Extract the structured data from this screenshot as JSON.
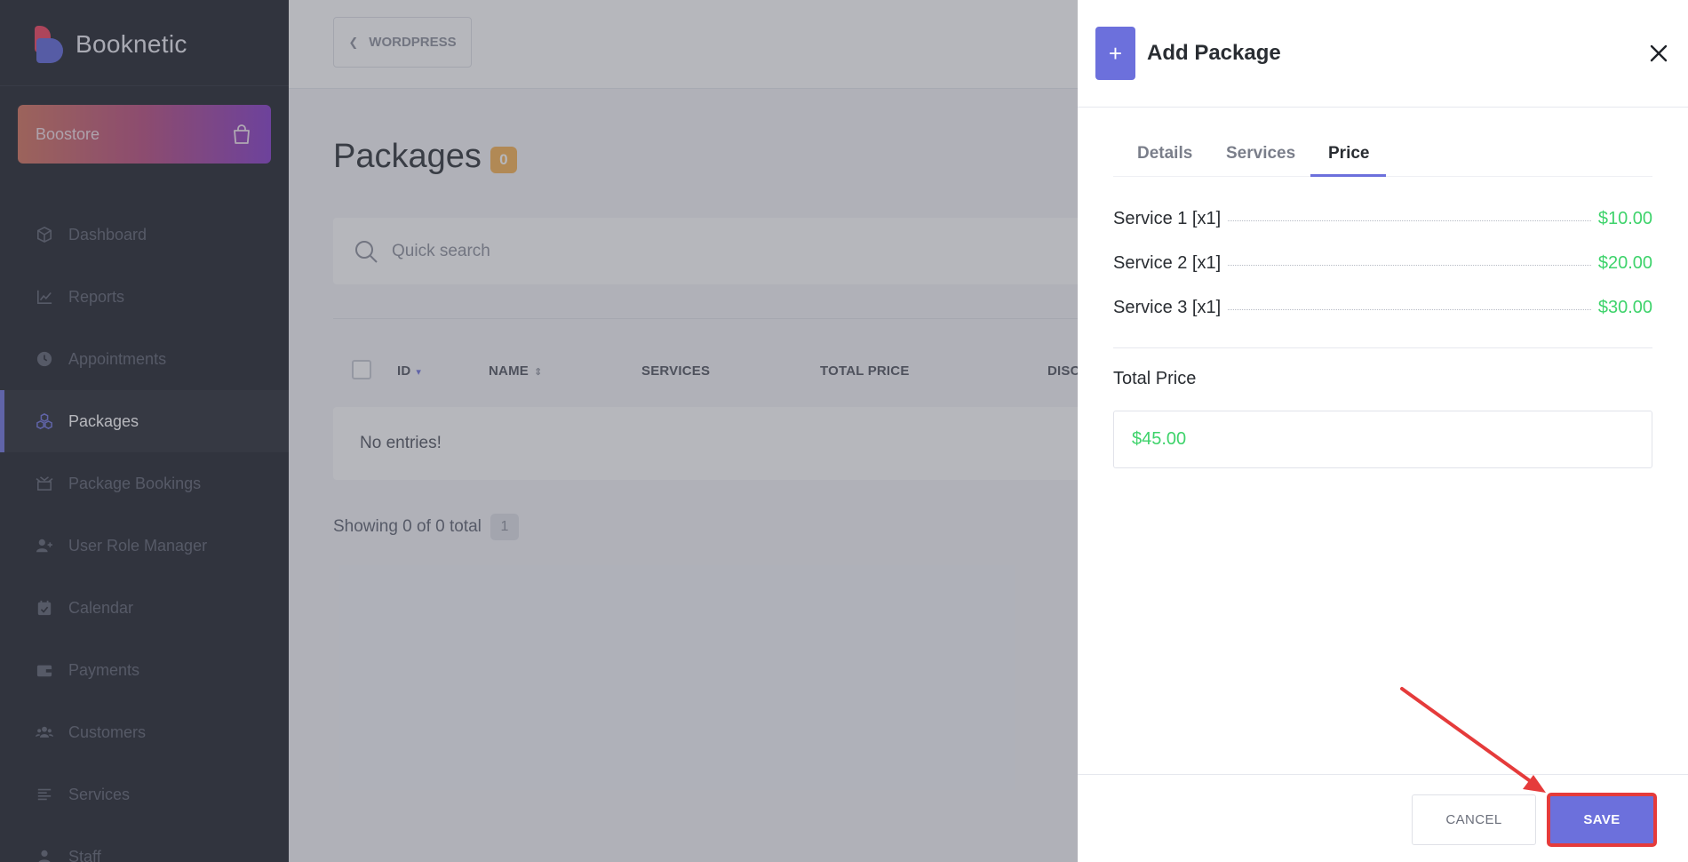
{
  "sidebar": {
    "brand": "Booknetic",
    "boostore_label": "Boostore",
    "items": [
      {
        "label": "Dashboard",
        "icon": "cube-icon",
        "active": false
      },
      {
        "label": "Reports",
        "icon": "chart-line-icon",
        "active": false
      },
      {
        "label": "Appointments",
        "icon": "clock-icon",
        "active": false
      },
      {
        "label": "Packages",
        "icon": "cubes-icon",
        "active": true
      },
      {
        "label": "Package Bookings",
        "icon": "box-open-icon",
        "active": false
      },
      {
        "label": "User Role Manager",
        "icon": "user-plus-icon",
        "active": false
      },
      {
        "label": "Calendar",
        "icon": "calendar-check-icon",
        "active": false
      },
      {
        "label": "Payments",
        "icon": "wallet-icon",
        "active": false
      },
      {
        "label": "Customers",
        "icon": "users-icon",
        "active": false
      },
      {
        "label": "Services",
        "icon": "list-icon",
        "active": false
      },
      {
        "label": "Staff",
        "icon": "user-icon",
        "active": false
      }
    ]
  },
  "main": {
    "back_label": "WORDPRESS",
    "page_title": "Packages",
    "count": "0",
    "search_placeholder": "Quick search",
    "columns": [
      "ID",
      "NAME",
      "SERVICES",
      "TOTAL PRICE",
      "DISC"
    ],
    "empty_text": "No entries!",
    "showing_text": "Showing 0 of 0 total",
    "page_number": "1"
  },
  "drawer": {
    "title": "Add Package",
    "add_symbol": "+",
    "tabs": [
      {
        "label": "Details",
        "active": false
      },
      {
        "label": "Services",
        "active": false
      },
      {
        "label": "Price",
        "active": true
      }
    ],
    "price_rows": [
      {
        "name": "Service 1 [x1]",
        "value": "$10.00"
      },
      {
        "name": "Service 2 [x1]",
        "value": "$20.00"
      },
      {
        "name": "Service 3 [x1]",
        "value": "$30.00"
      }
    ],
    "total_label": "Total Price",
    "total_value": "$45.00",
    "cancel_label": "CANCEL",
    "save_label": "SAVE"
  },
  "colors": {
    "accent": "#6c70dc",
    "price_green": "#3ed36b",
    "annotation_red": "#e53b3b",
    "sidebar_bg": "#1b1e27",
    "badge": "#f7b04f"
  }
}
